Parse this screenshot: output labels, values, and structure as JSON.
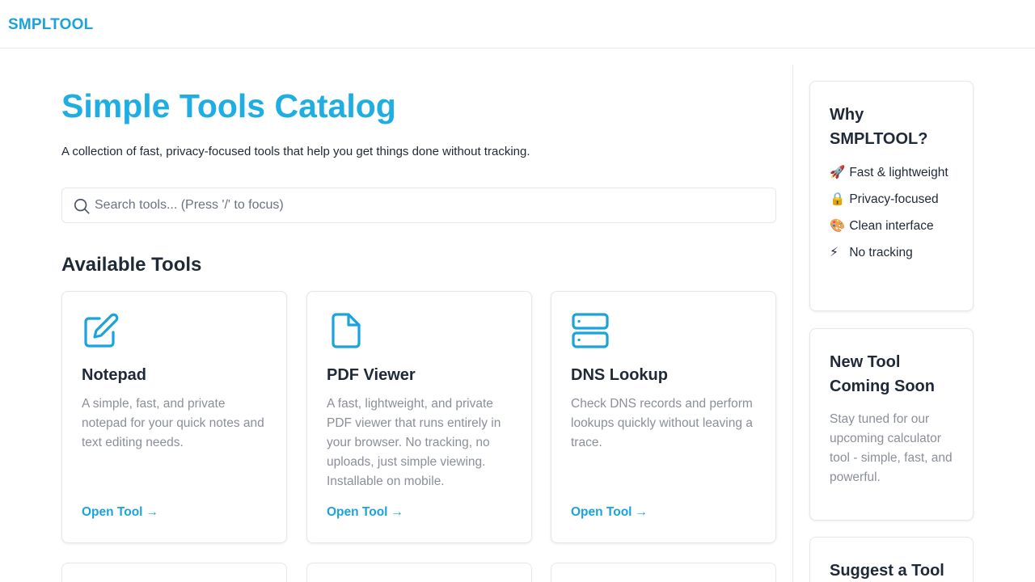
{
  "header": {
    "logo": "SMPLTOOL"
  },
  "main": {
    "title": "Simple Tools Catalog",
    "subtitle": "A collection of fast, privacy-focused tools that help you get things done without tracking.",
    "search": {
      "placeholder": "Search tools... (Press '/' to focus)",
      "value": ""
    },
    "section_title": "Available Tools",
    "tools": [
      {
        "icon": "edit-icon",
        "title": "Notepad",
        "description": "A simple, fast, and private notepad for your quick notes and text editing needs.",
        "link_label": "Open Tool"
      },
      {
        "icon": "file-icon",
        "title": "PDF Viewer",
        "description": "A fast, lightweight, and private PDF viewer that runs entirely in your browser. No tracking, no uploads, just simple viewing. Installable on mobile.",
        "link_label": "Open Tool"
      },
      {
        "icon": "server-icon",
        "title": "DNS Lookup",
        "description": "Check DNS records and perform lookups quickly without leaving a trace.",
        "link_label": "Open Tool"
      }
    ]
  },
  "sidebar": {
    "why": {
      "title": "Why SMPLTOOL?",
      "items": [
        {
          "icon": "🚀",
          "label": "Fast & lightweight"
        },
        {
          "icon": "🔒",
          "label": "Privacy-focused"
        },
        {
          "icon": "🎨",
          "label": "Clean interface"
        },
        {
          "icon": "⚡",
          "label": "No tracking"
        }
      ]
    },
    "coming_soon": {
      "title": "New Tool Coming Soon",
      "text": "Stay tuned for our upcoming calculator tool - simple, fast, and powerful."
    },
    "suggest": {
      "title": "Suggest a Tool"
    }
  },
  "colors": {
    "accent": "#1aa3dc",
    "title": "#1eaee4",
    "muted_text": "#8b8f97",
    "border": "#e5e7eb"
  }
}
